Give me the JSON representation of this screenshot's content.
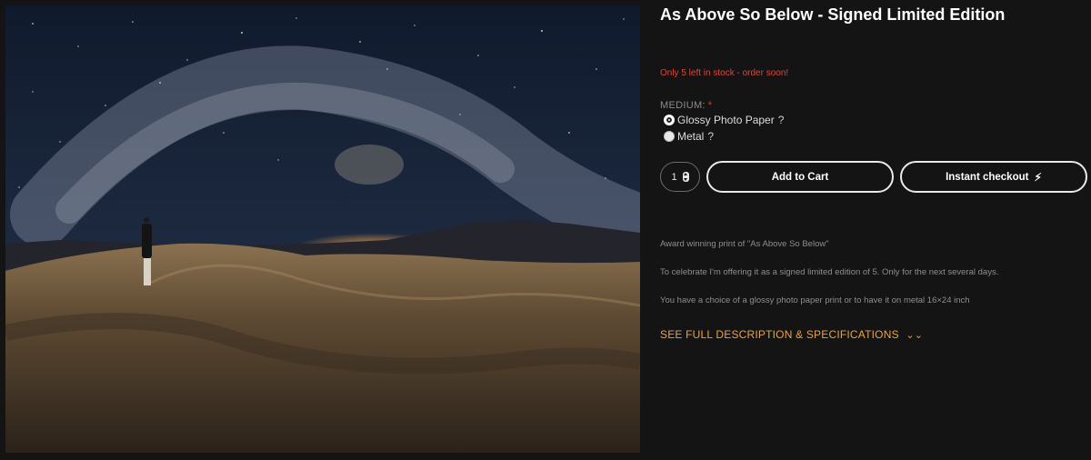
{
  "product": {
    "title": "As Above So Below - Signed Limited Edition",
    "stock_notice": "Only 5 left in stock - order soon!",
    "stock_color": "#d9473e",
    "image_alt": "Milky Way arching over sand dunes with a person looking up"
  },
  "medium": {
    "label": "MEDIUM:",
    "required_marker": "*",
    "options": [
      {
        "label": "Glossy Photo Paper",
        "help": "?",
        "selected": true
      },
      {
        "label": "Metal",
        "help": "?",
        "selected": false
      }
    ]
  },
  "purchase": {
    "quantity": "1",
    "add_to_cart_label": "Add to Cart",
    "instant_checkout_label": "Instant checkout",
    "instant_icon": "lightning-icon"
  },
  "description": {
    "lines": [
      "Award winning print of \"As Above So Below\"",
      "To celebrate I'm offering it as a signed limited edition of 5. Only for the next several days.",
      "You have a choice of a glossy photo paper print or to have it on metal 16×24 inch"
    ],
    "full_link": "SEE FULL DESCRIPTION & SPECIFICATIONS",
    "full_link_icon": "double-chevron-down-icon",
    "accent_color": "#e6a24a"
  }
}
